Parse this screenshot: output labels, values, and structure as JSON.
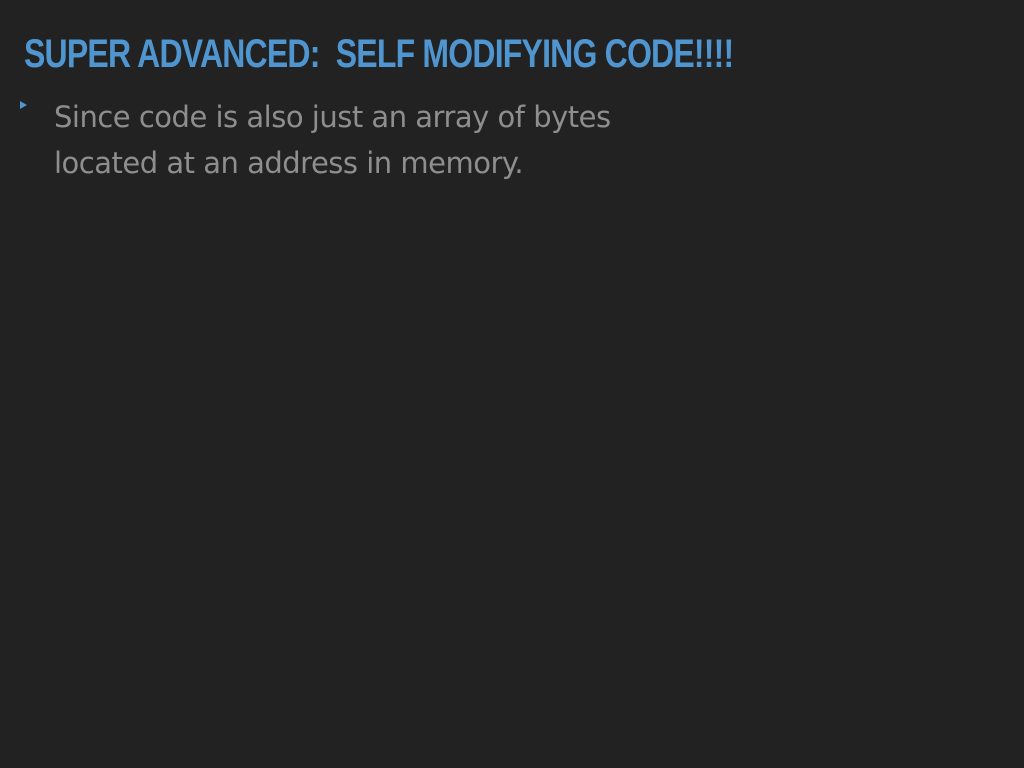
{
  "slide": {
    "title": "SUPER ADVANCED:  SELF MODIFYING CODE!!!!",
    "bullets": [
      "Since code is also just an array of bytes located at an address in memory."
    ]
  },
  "colors": {
    "background": "#222222",
    "title": "#4f95cf",
    "body_text": "#8e8e8e",
    "bullet_marker": "#4f95cf"
  },
  "icons": {
    "bullet": "triangle-bullet-icon"
  }
}
